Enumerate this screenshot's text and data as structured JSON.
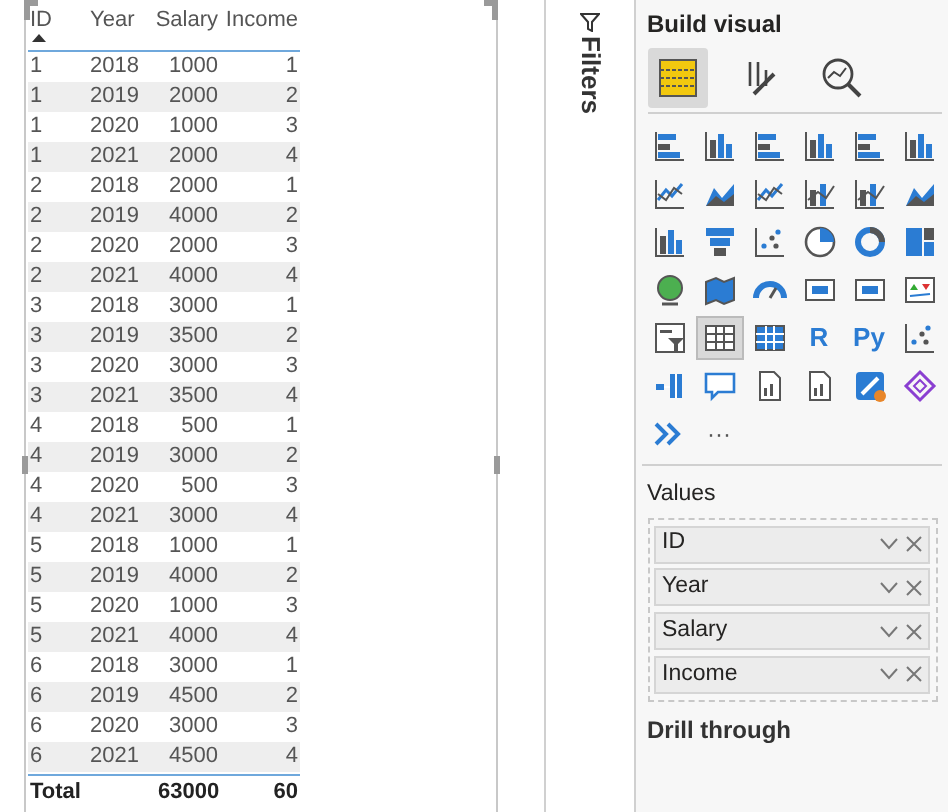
{
  "table": {
    "columns": [
      {
        "label": "ID",
        "sorted": true,
        "kind": "text"
      },
      {
        "label": "Year",
        "sorted": false,
        "kind": "text"
      },
      {
        "label": "Salary",
        "sorted": false,
        "kind": "number"
      },
      {
        "label": "Income",
        "sorted": false,
        "kind": "number"
      }
    ],
    "rows": [
      [
        "1",
        "2018",
        "1000",
        "1"
      ],
      [
        "1",
        "2019",
        "2000",
        "2"
      ],
      [
        "1",
        "2020",
        "1000",
        "3"
      ],
      [
        "1",
        "2021",
        "2000",
        "4"
      ],
      [
        "2",
        "2018",
        "2000",
        "1"
      ],
      [
        "2",
        "2019",
        "4000",
        "2"
      ],
      [
        "2",
        "2020",
        "2000",
        "3"
      ],
      [
        "2",
        "2021",
        "4000",
        "4"
      ],
      [
        "3",
        "2018",
        "3000",
        "1"
      ],
      [
        "3",
        "2019",
        "3500",
        "2"
      ],
      [
        "3",
        "2020",
        "3000",
        "3"
      ],
      [
        "3",
        "2021",
        "3500",
        "4"
      ],
      [
        "4",
        "2018",
        "500",
        "1"
      ],
      [
        "4",
        "2019",
        "3000",
        "2"
      ],
      [
        "4",
        "2020",
        "500",
        "3"
      ],
      [
        "4",
        "2021",
        "3000",
        "4"
      ],
      [
        "5",
        "2018",
        "1000",
        "1"
      ],
      [
        "5",
        "2019",
        "4000",
        "2"
      ],
      [
        "5",
        "2020",
        "1000",
        "3"
      ],
      [
        "5",
        "2021",
        "4000",
        "4"
      ],
      [
        "6",
        "2018",
        "3000",
        "1"
      ],
      [
        "6",
        "2019",
        "4500",
        "2"
      ],
      [
        "6",
        "2020",
        "3000",
        "3"
      ],
      [
        "6",
        "2021",
        "4500",
        "4"
      ]
    ],
    "total": {
      "label": "Total",
      "values": [
        "63000",
        "60"
      ]
    }
  },
  "filters_pane": {
    "title": "Filters"
  },
  "build_pane": {
    "title": "Build visual",
    "tabs": [
      {
        "kind": "fields",
        "selected": true
      },
      {
        "kind": "format",
        "selected": false
      },
      {
        "kind": "analytics",
        "selected": false
      }
    ],
    "visuals": [
      {
        "kind": "hbar",
        "selected": false
      },
      {
        "kind": "vbar",
        "selected": false
      },
      {
        "kind": "hbar",
        "selected": false
      },
      {
        "kind": "vbar",
        "selected": false
      },
      {
        "kind": "hbar",
        "selected": false
      },
      {
        "kind": "vbar",
        "selected": false
      },
      {
        "kind": "line",
        "selected": false
      },
      {
        "kind": "area",
        "selected": false
      },
      {
        "kind": "line",
        "selected": false
      },
      {
        "kind": "combo",
        "selected": false
      },
      {
        "kind": "combo",
        "selected": false
      },
      {
        "kind": "area",
        "selected": false
      },
      {
        "kind": "vbar",
        "selected": false
      },
      {
        "kind": "funnel",
        "selected": false
      },
      {
        "kind": "scatter",
        "selected": false
      },
      {
        "kind": "pie",
        "selected": false
      },
      {
        "kind": "donut",
        "selected": false
      },
      {
        "kind": "treemap",
        "selected": false
      },
      {
        "kind": "globe",
        "selected": false
      },
      {
        "kind": "map",
        "selected": false
      },
      {
        "kind": "gauge",
        "selected": false
      },
      {
        "kind": "card",
        "selected": false
      },
      {
        "kind": "card",
        "selected": false
      },
      {
        "kind": "kpi",
        "selected": false
      },
      {
        "kind": "slicer",
        "selected": false
      },
      {
        "kind": "table",
        "selected": true
      },
      {
        "kind": "matrix",
        "selected": false
      },
      {
        "kind": "text",
        "label": "R",
        "selected": false
      },
      {
        "kind": "text",
        "label": "Py",
        "selected": false
      },
      {
        "kind": "scatter",
        "selected": false
      },
      {
        "kind": "tree",
        "selected": false
      },
      {
        "kind": "chat",
        "selected": false
      },
      {
        "kind": "doc",
        "selected": false
      },
      {
        "kind": "doc",
        "selected": false
      },
      {
        "kind": "apps",
        "selected": false
      },
      {
        "kind": "diamond",
        "selected": false
      },
      {
        "kind": "chevrons",
        "selected": false
      },
      {
        "kind": "text",
        "label": "···",
        "selected": false
      }
    ],
    "values_label": "Values",
    "fields": [
      "ID",
      "Year",
      "Salary",
      "Income"
    ],
    "drill_label": "Drill through"
  }
}
